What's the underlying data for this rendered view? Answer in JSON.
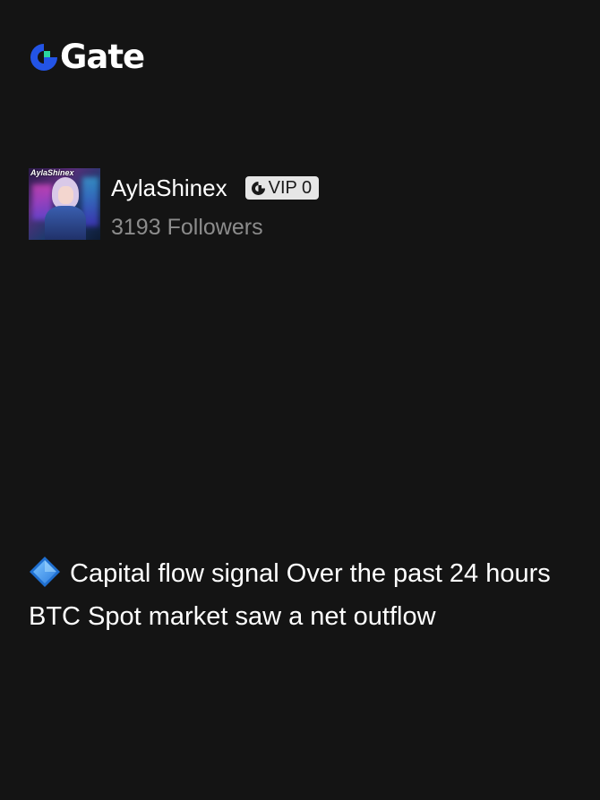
{
  "brand": {
    "name": "Gate",
    "logo_icon": "gate-logo-icon",
    "accent_color": "#2354e6"
  },
  "profile": {
    "username": "AylaShinex",
    "avatar_caption": "AylaShinex",
    "vip_label": "VIP 0",
    "followers_count": "3193",
    "followers_label": "Followers"
  },
  "post": {
    "icon": "blue-diamond-icon",
    "text": "Capital flow signal Over the past 24 hours BTC Spot market saw a net outflow"
  }
}
